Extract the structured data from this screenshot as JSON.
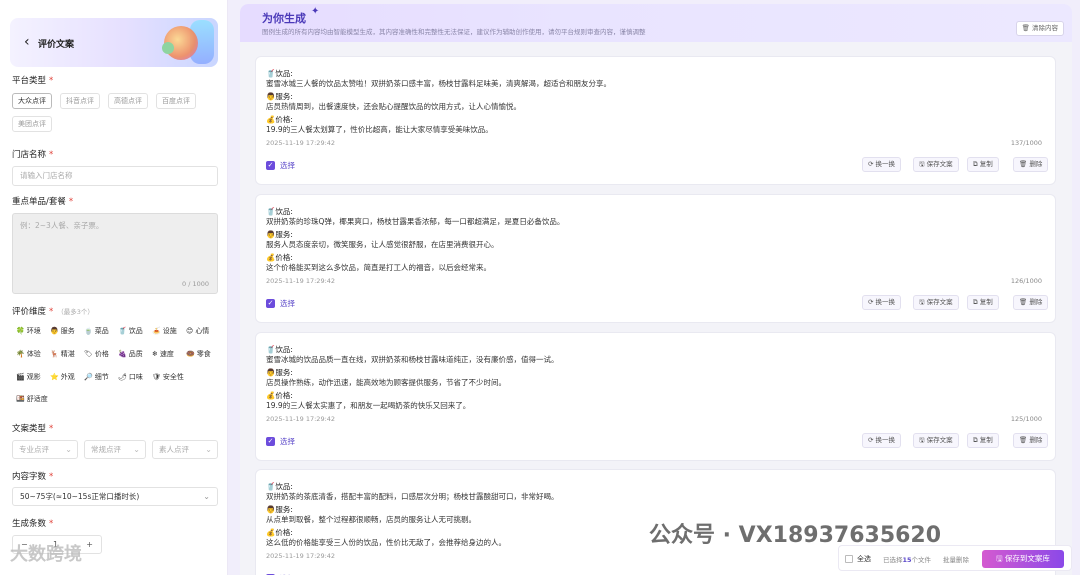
{
  "left": {
    "title": "评价文案",
    "platform": {
      "label": "平台类型",
      "req": "*",
      "options": [
        "大众点评",
        "抖音点评",
        "高德点评",
        "百度点评",
        "美团点评"
      ]
    },
    "store": {
      "label": "门店名称",
      "req": "*",
      "placeholder": "请输入门店名称"
    },
    "product": {
      "label": "重点单品/套餐",
      "req": "*",
      "placeholder": "例：2~3人餐、亲子票。",
      "count": "0 / 1000"
    },
    "dims": {
      "label": "评价维度",
      "req": "*",
      "hint": "（最多3个）",
      "items": [
        {
          "icon": "🍀",
          "text": "环境"
        },
        {
          "icon": "👨",
          "text": "服务"
        },
        {
          "icon": "🍵",
          "text": "菜品"
        },
        {
          "icon": "🥤",
          "text": "饮品"
        },
        {
          "icon": "🍝",
          "text": "设施"
        },
        {
          "icon": "😊",
          "text": "心情"
        },
        {
          "icon": "🌴",
          "text": "体验"
        },
        {
          "icon": "🦌",
          "text": "精湛"
        },
        {
          "icon": "🏷",
          "text": "价格"
        },
        {
          "icon": "🍇",
          "text": "品质"
        },
        {
          "icon": "❄",
          "text": "速度"
        },
        {
          "icon": "🍩",
          "text": "零食"
        },
        {
          "icon": "🎬",
          "text": "观影"
        },
        {
          "icon": "⭐",
          "text": "外观"
        },
        {
          "icon": "🔎",
          "text": "细节"
        },
        {
          "icon": "🌶",
          "text": "口味"
        },
        {
          "icon": "🛡",
          "text": "安全性"
        },
        {
          "icon": "🍱",
          "text": "舒适度"
        }
      ]
    },
    "copytype": {
      "label": "文案类型",
      "req": "*",
      "options": [
        "专业点评",
        "常规点评",
        "素人点评"
      ]
    },
    "wordcount": {
      "label": "内容字数",
      "req": "*",
      "value": "50~75字(≈10~15s正常口播时长)"
    },
    "gen": {
      "label": "生成条数",
      "req": "*",
      "minus": "−",
      "value": "1",
      "plus": "+"
    }
  },
  "right": {
    "title": "为你生成",
    "sparkle": "✦",
    "subtitle": "图例生成的所有内容均由智能模型生成，其内容准确性和完整性无法保证，建议作为辅助创作使用，请勿平台规则审查内容，谨慎调整",
    "clear": "🗑 清除内容",
    "cards": [
      {
        "lines": [
          {
            "h": "🥤饮品:",
            "t": "蜜雪冰城三人餐的饮品太赞啦！双拼奶茶口感丰富，杨枝甘露料足味美，清爽解渴，超适合和朋友分享。"
          },
          {
            "h": "👨服务:",
            "t": "店员热情周到，出餐速度快，还会贴心提醒饮品的饮用方式，让人心情愉悦。"
          },
          {
            "h": "💰价格:",
            "t": "19.9的三人餐太划算了，性价比超高，能让大家尽情享受美味饮品。"
          }
        ],
        "ts": "2025-11-19 17:29:42",
        "count": "137/1000"
      },
      {
        "lines": [
          {
            "h": "🥤饮品:",
            "t": "双拼奶茶的珍珠Q弹，椰果爽口，杨枝甘露果香浓郁，每一口都超满足，是夏日必备饮品。"
          },
          {
            "h": "👨服务:",
            "t": "服务人员态度亲切，微笑服务，让人感觉很舒服，在店里消费很开心。"
          },
          {
            "h": "💰价格:",
            "t": "这个价格能买到这么多饮品，简直是打工人的福音，以后会经常来。"
          }
        ],
        "ts": "2025-11-19 17:29:42",
        "count": "126/1000"
      },
      {
        "lines": [
          {
            "h": "🥤饮品:",
            "t": "蜜雪冰城的饮品品质一直在线，双拼奶茶和杨枝甘露味道纯正，没有廉价感，值得一试。"
          },
          {
            "h": "👨服务:",
            "t": "店员操作熟练，动作迅速，能高效地为顾客提供服务，节省了不少时间。"
          },
          {
            "h": "💰价格:",
            "t": "19.9的三人餐太实惠了，和朋友一起喝奶茶的快乐又回来了。"
          }
        ],
        "ts": "2025-11-19 17:29:42",
        "count": "125/1000"
      },
      {
        "lines": [
          {
            "h": "🥤饮品:",
            "t": "双拼奶茶的茶底清香，搭配丰富的配料，口感层次分明；杨枝甘露酸甜可口，非常好喝。"
          },
          {
            "h": "👨服务:",
            "t": "从点单到取餐，整个过程都很顺畅，店员的服务让人无可挑剔。"
          },
          {
            "h": "💰价格:",
            "t": "这么低的价格能享受三人份的饮品，性价比无敌了，会推荐给身边的人。"
          }
        ],
        "ts": "2025-11-19 17:29:42",
        "count": ""
      }
    ],
    "actions": {
      "select": "选择",
      "regen": "换一换",
      "save": "保存文案",
      "copy": "复制",
      "del": "删除"
    },
    "bottom": {
      "all": "全选",
      "sel_pre": "已选择",
      "sel_n": "15",
      "sel_post": "个文件",
      "batch_del": "批量删除",
      "save_lib": "保存到文案库"
    }
  },
  "watermark": {
    "main": "公众号 · VX18937635620",
    "left": "大数跨境"
  }
}
